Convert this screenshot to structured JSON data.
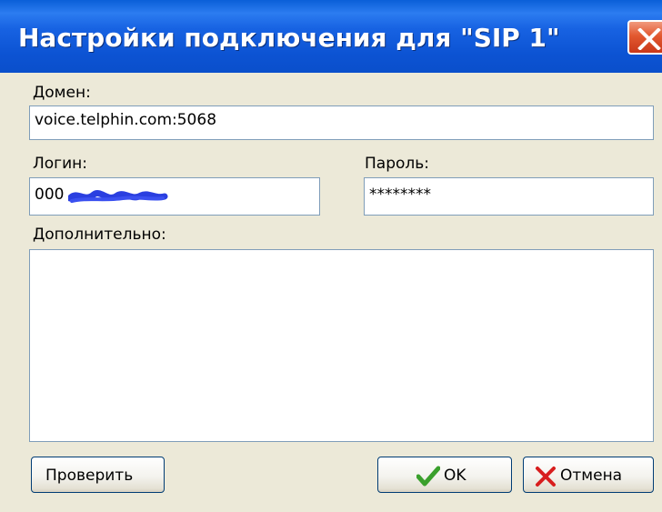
{
  "window": {
    "title": "Настройки подключения для \"SIP 1\""
  },
  "form": {
    "domain_label": "Домен:",
    "domain_value": "voice.telphin.com:5068",
    "login_label": "Логин:",
    "login_value": "000",
    "password_label": "Пароль:",
    "password_value": "********",
    "extra_label": "Дополнительно:",
    "extra_value": ""
  },
  "buttons": {
    "check_label": "Проверить",
    "ok_label": "OK",
    "cancel_label": "Отмена"
  },
  "icons": {
    "close": "close-icon",
    "ok": "checkmark-icon",
    "cancel": "cross-icon"
  },
  "colors": {
    "titlebar": "#0c53d3",
    "close_button": "#e2582f",
    "checkmark": "#3aa02c",
    "cross": "#d81e1e",
    "redaction": "#2a3fe0"
  }
}
